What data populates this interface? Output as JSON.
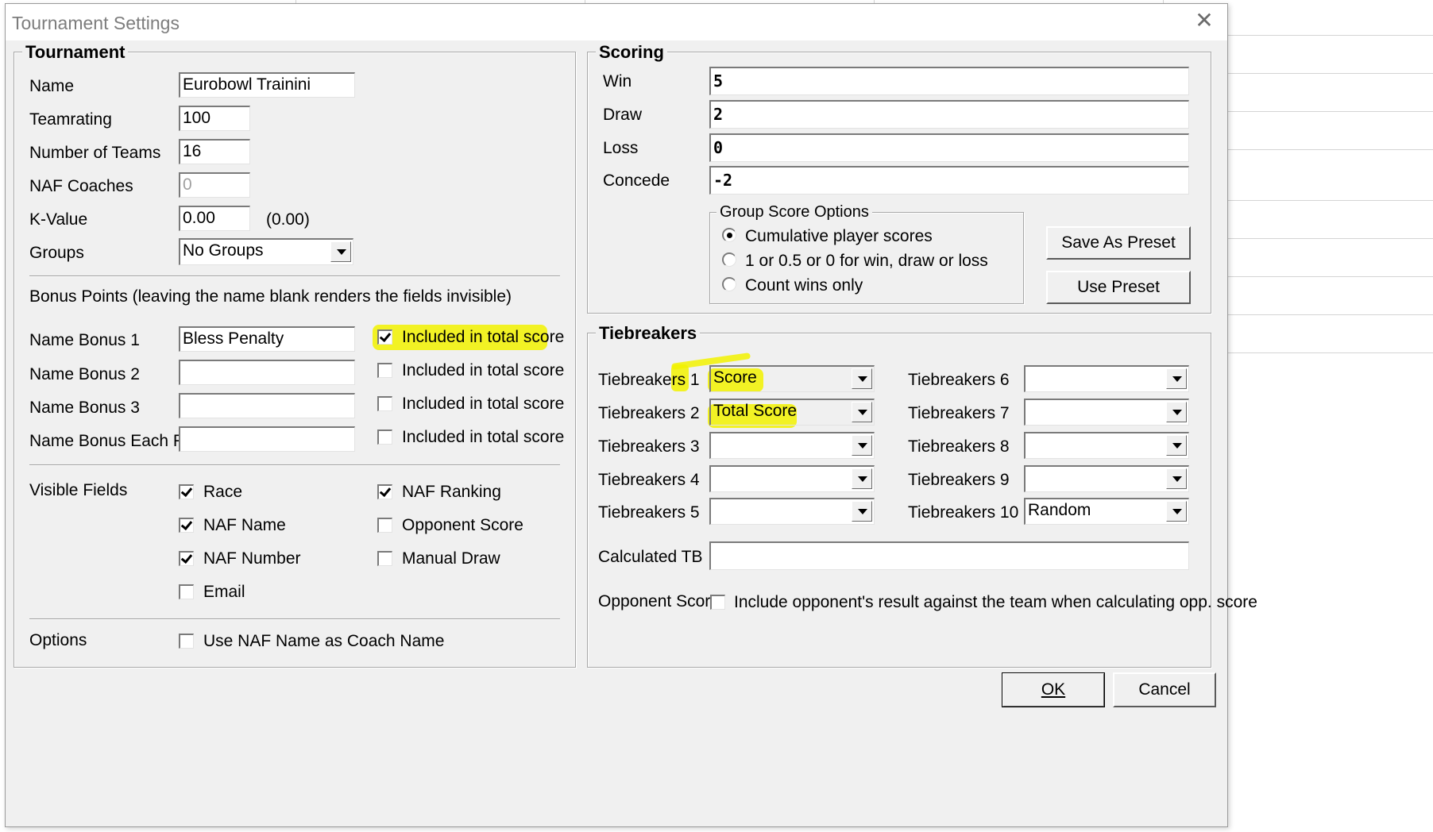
{
  "window": {
    "title": "Tournament Settings",
    "close_label": "✕"
  },
  "tournament": {
    "legend": "Tournament",
    "name_label": "Name",
    "name_value": "Eurobowl Trainini",
    "teamrating_label": "Teamrating",
    "teamrating_value": "100",
    "num_teams_label": "Number of Teams",
    "num_teams_value": "16",
    "naf_coaches_label": "NAF Coaches",
    "naf_coaches_value": "0",
    "kvalue_label": "K-Value",
    "kvalue_value": "0.00",
    "kvalue_note": "(0.00)",
    "groups_label": "Groups",
    "groups_value": "No Groups",
    "bonus_header": "Bonus Points (leaving the name blank renders the fields invisible)",
    "bonus": [
      {
        "label": "Name Bonus 1",
        "value": "Bless Penalty",
        "included_label": "Included in total score",
        "checked": true
      },
      {
        "label": "Name Bonus 2",
        "value": "",
        "included_label": "Included in total score",
        "checked": false
      },
      {
        "label": "Name Bonus 3",
        "value": "",
        "included_label": "Included in total score",
        "checked": false
      },
      {
        "label": "Name Bonus Each Ro",
        "value": "",
        "included_label": "Included in total score",
        "checked": false
      }
    ],
    "visible_fields_label": "Visible Fields",
    "visible_fields": {
      "race": "Race",
      "naf_name": "NAF Name",
      "naf_number": "NAF Number",
      "email": "Email",
      "naf_ranking": "NAF Ranking",
      "opponent_score": "Opponent Score",
      "manual_draw": "Manual Draw"
    },
    "options_label": "Options",
    "use_naf_name_label": "Use NAF Name as Coach Name"
  },
  "scoring": {
    "legend": "Scoring",
    "win_label": "Win",
    "win_value": "5",
    "draw_label": "Draw",
    "draw_value": "2",
    "loss_label": "Loss",
    "loss_value": "0",
    "concede_label": "Concede",
    "concede_value": "-2",
    "group_options_legend": "Group Score Options",
    "group_options": [
      "Cumulative player scores",
      "1 or 0.5 or 0 for win, draw or loss",
      "Count wins only"
    ],
    "save_preset_label": "Save As Preset",
    "use_preset_label": "Use Preset"
  },
  "tiebreakers": {
    "legend": "Tiebreakers",
    "items": [
      {
        "label": "Tiebreakers 1",
        "value": "Score"
      },
      {
        "label": "Tiebreakers 2",
        "value": "Total Score"
      },
      {
        "label": "Tiebreakers 3",
        "value": ""
      },
      {
        "label": "Tiebreakers 4",
        "value": ""
      },
      {
        "label": "Tiebreakers 5",
        "value": ""
      },
      {
        "label": "Tiebreakers 6",
        "value": ""
      },
      {
        "label": "Tiebreakers 7",
        "value": ""
      },
      {
        "label": "Tiebreakers 8",
        "value": ""
      },
      {
        "label": "Tiebreakers 9",
        "value": ""
      },
      {
        "label": "Tiebreakers 10",
        "value": "Random"
      }
    ],
    "calculated_label": "Calculated TB",
    "calculated_value": "",
    "opponent_score_label": "Opponent Score",
    "opponent_score_desc": "Include opponent's result against the team when calculating opp. score"
  },
  "buttons": {
    "ok": "OK",
    "cancel": "Cancel"
  },
  "colors": {
    "highlight": "#f2f200",
    "dialog_bg": "#f0f0f0"
  }
}
